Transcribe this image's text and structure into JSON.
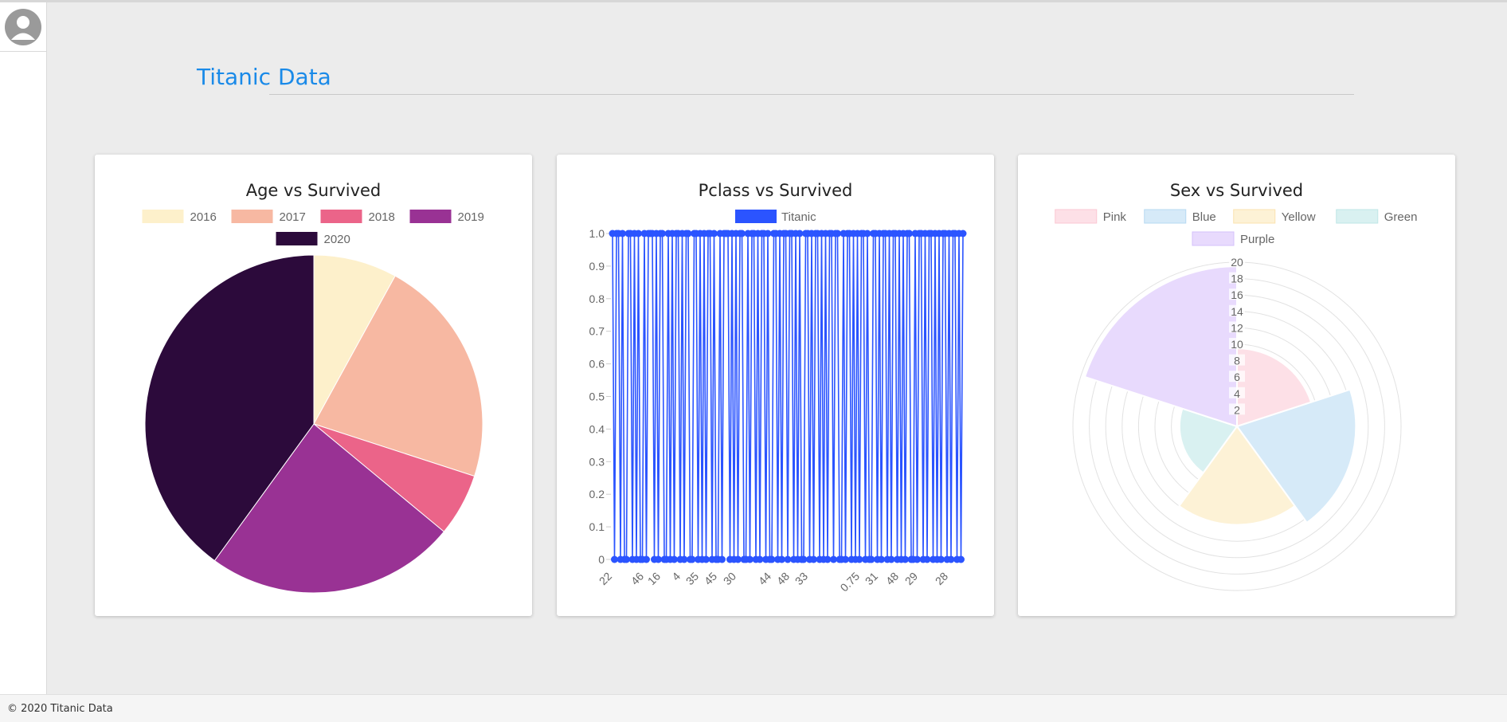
{
  "header": {
    "title": "Titanic Data"
  },
  "sidebar": {
    "avatar_icon": "user-avatar-icon"
  },
  "footer": {
    "text": "© 2020 Titanic Data"
  },
  "chart_data": [
    {
      "type": "pie",
      "title": "Age vs Survived",
      "labels": [
        "2016",
        "2017",
        "2018",
        "2019",
        "2020"
      ],
      "values": [
        8,
        22,
        6,
        24,
        40
      ],
      "colors": [
        "#fdf0cb",
        "#f7b8a2",
        "#eb6489",
        "#993294",
        "#2c0a3b"
      ],
      "legend": "top"
    },
    {
      "type": "line",
      "title": "Pclass vs Survived",
      "series": [
        {
          "name": "Titanic",
          "color": "#2b54ff"
        }
      ],
      "ylim": [
        0,
        1
      ],
      "yticks": [
        "0",
        "0.1",
        "0.2",
        "0.3",
        "0.4",
        "0.5",
        "0.6",
        "0.7",
        "0.8",
        "0.9",
        "1.0"
      ],
      "xticks": [
        "22",
        "46",
        "16",
        "4",
        "35",
        "45",
        "30",
        "44",
        "48",
        "33",
        "0.75",
        "31",
        "48",
        "29",
        "28"
      ],
      "values": [
        1,
        0,
        1,
        1,
        0,
        1,
        0,
        0,
        1,
        1,
        0,
        1,
        0,
        1,
        0,
        0,
        1,
        0,
        1,
        1,
        1,
        0,
        1,
        0,
        1,
        1,
        0,
        0,
        1,
        0,
        1,
        0,
        1,
        1,
        0,
        1,
        0,
        1,
        1,
        0,
        0,
        1,
        1,
        0,
        1,
        0,
        1,
        0,
        1,
        1,
        0,
        1,
        0,
        0,
        1,
        0,
        1,
        1,
        1,
        0,
        1,
        0,
        1,
        0,
        1,
        1,
        0,
        0,
        1,
        0,
        1,
        1,
        0,
        1,
        0,
        1,
        1,
        0,
        1,
        0,
        0,
        1,
        1,
        0,
        1,
        0,
        1,
        1,
        0,
        1,
        1,
        0,
        1,
        0,
        1,
        0,
        0,
        1,
        1,
        0,
        1,
        0,
        1,
        1,
        0,
        1,
        0,
        1,
        0,
        1,
        1,
        0,
        1,
        1,
        0,
        0,
        1,
        0,
        1,
        1,
        0,
        1,
        0,
        1,
        0,
        1,
        1,
        0,
        1,
        0,
        0,
        1,
        1,
        0,
        1,
        0,
        1,
        1,
        0,
        1,
        0,
        1,
        1,
        0,
        1,
        0,
        1,
        0,
        1,
        1,
        0,
        0,
        1,
        0,
        1,
        1,
        0,
        1,
        0,
        1,
        1,
        0,
        1,
        0,
        1,
        0,
        1,
        1,
        0,
        1,
        0,
        1,
        1,
        0,
        1,
        0,
        1
      ],
      "legend": "top"
    },
    {
      "type": "polarArea",
      "title": "Sex vs Survived",
      "labels": [
        "Pink",
        "Blue",
        "Yellow",
        "Green",
        "Purple"
      ],
      "values": [
        9.5,
        14.5,
        12,
        7,
        19.5
      ],
      "colors": [
        "#fde0e7",
        "#d6eaf8",
        "#fdf2d6",
        "#d9f1f1",
        "#e8dafd"
      ],
      "borderColors": [
        "#fbc7d3",
        "#b7d9f2",
        "#fbe3b0",
        "#bfe6e6",
        "#d4c1fb"
      ],
      "rticks": [
        "2",
        "4",
        "6",
        "8",
        "10",
        "12",
        "14",
        "16",
        "18",
        "20"
      ],
      "rmax": 20,
      "legend": "top"
    }
  ]
}
